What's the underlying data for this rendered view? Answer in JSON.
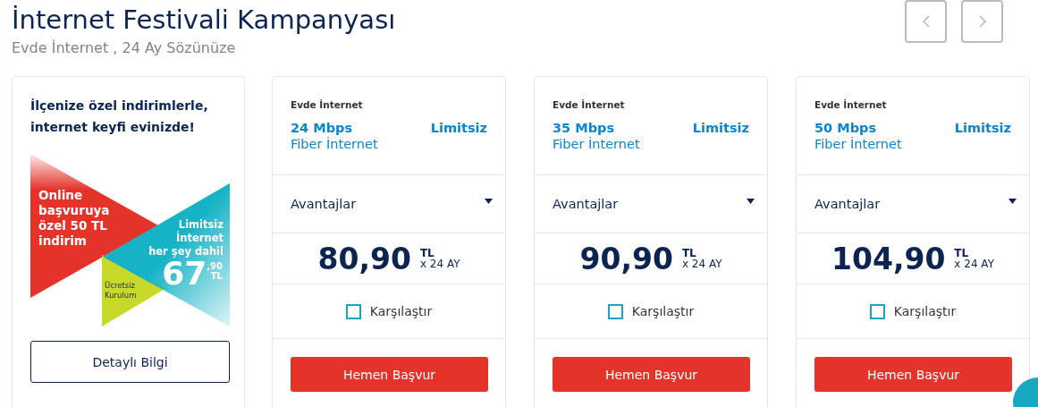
{
  "header": {
    "title": "İnternet Festivali Kampanyası",
    "subtitle": "Evde İnternet , 24 Ay Sözünüze"
  },
  "promo": {
    "headline": "İlçenize özel indirimlerle, internet keyfi evinizde!",
    "banner": {
      "offer_lines": [
        "Online",
        "başvuruya",
        "özel 50 TL",
        "indirim"
      ],
      "plan_lines": [
        "Limitsiz",
        "İnternet",
        "her şey dahil"
      ],
      "price_main": "67",
      "price_decimal": ",90",
      "currency": "TL",
      "extra_lines": [
        "Ücretsiz",
        "Kurulum"
      ]
    },
    "button": "Detaylı Bilgi"
  },
  "plans": [
    {
      "category": "Evde İnternet",
      "speed": "24 Mbps",
      "type": "Fiber İnternet",
      "quota": "Limitsiz",
      "advantages_label": "Avantajlar",
      "expanded": false,
      "price": "80,90",
      "currency": "TL",
      "term": "x 24 AY",
      "compare_label": "Karşılaştır",
      "compare_checked": false,
      "button": "Hemen Başvur"
    },
    {
      "category": "Evde İnternet",
      "speed": "35 Mbps",
      "type": "Fiber İnternet",
      "quota": "Limitsiz",
      "advantages_label": "Avantajlar",
      "expanded": false,
      "price": "90,90",
      "currency": "TL",
      "term": "x 24 AY",
      "compare_label": "Karşılaştır",
      "compare_checked": false,
      "button": "Hemen Başvur"
    },
    {
      "category": "Evde İnternet",
      "speed": "50 Mbps",
      "type": "Fiber İnternet",
      "quota": "Limitsiz",
      "advantages_label": "Avantajlar",
      "expanded": false,
      "price": "104,90",
      "currency": "TL",
      "term": "x 24 AY",
      "compare_label": "Karşılaştır",
      "compare_checked": false,
      "button": "Hemen Başvur"
    }
  ]
}
